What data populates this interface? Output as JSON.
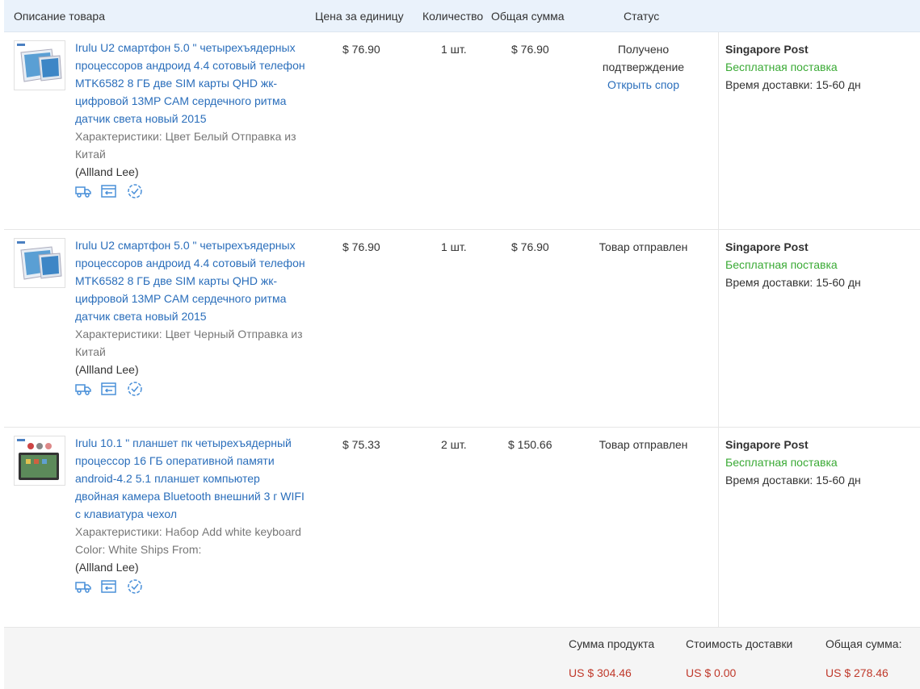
{
  "header": {
    "description": "Описание товара",
    "unit_price": "Цена за единицу",
    "quantity": "Количество",
    "total": "Общая сумма",
    "status": "Статус"
  },
  "orders": [
    {
      "title": "Irulu U2 смартфон 5.0 \" четырехъядерных процессоров андроид 4.4 сотовый телефон MTK6582 8 ГБ две SIM карты QHD жк-цифровой 13MP CAM сердечного ритма датчик света новый 2015",
      "specs": "Характеристики: Цвет Белый  Отправка из Китай",
      "seller": "(Allland Lee)",
      "price": "$ 76.90",
      "qty": "1 шт.",
      "sum": "$ 76.90",
      "status_line1": "Получено",
      "status_line2": "подтверждение",
      "dispute": "Открыть спор",
      "carrier": "Singapore Post",
      "free": "Бесплатная поставка",
      "delivery": "Время доставки:  15-60 дн"
    },
    {
      "title": "Irulu U2 смартфон 5.0 \" четырехъядерных процессоров андроид 4.4 сотовый телефон MTK6582 8 ГБ две SIM карты QHD жк-цифровой 13MP CAM сердечного ритма датчик света новый 2015",
      "specs": "Характеристики: Цвет Черный  Отправка из Китай",
      "seller": "(Allland Lee)",
      "price": "$ 76.90",
      "qty": "1 шт.",
      "sum": "$ 76.90",
      "status": "Товар отправлен",
      "carrier": "Singapore Post",
      "free": "Бесплатная поставка",
      "delivery": "Время доставки:  15-60 дн"
    },
    {
      "title": "Irulu 10.1 \" планшет пк четырехъядерный процессор 16 ГБ оперативной памяти android-4.2 5.1 планшет компьютер двойная камера Bluetooth внешний 3 г WIFI с клавиатура чехол",
      "specs": "Характеристики: Набор Add white keyboard    Color: White    Ships From:",
      "seller": "(Allland Lee)",
      "price": "$ 75.33",
      "qty": "2 шт.",
      "sum": "$ 150.66",
      "status": "Товар отправлен",
      "carrier": "Singapore Post",
      "free": "Бесплатная поставка",
      "delivery": "Время доставки:  15-60 дн"
    }
  ],
  "footer": {
    "product_sum_label": "Сумма продукта",
    "product_sum": "US $ 304.46",
    "shipping_label": "Стоимость доставки",
    "shipping": "US $ 0.00",
    "total_label": "Общая сумма:",
    "total": "US $ 278.46"
  },
  "icons": [
    "shipping-truck-icon",
    "return-icon",
    "confirm-receipt-icon"
  ],
  "colors": {
    "link": "#2a6ebb",
    "free_shipping": "#3aaa35",
    "price_red": "#c0392b",
    "header_bg": "#eaf2fb"
  }
}
